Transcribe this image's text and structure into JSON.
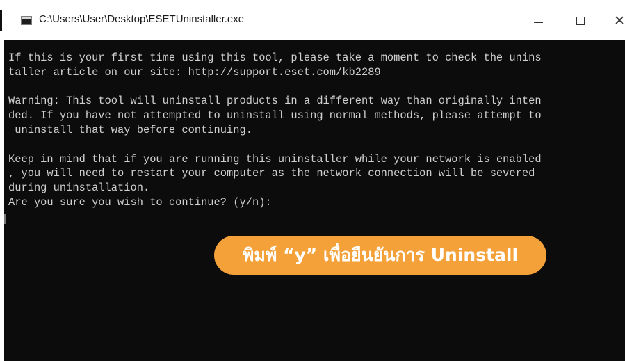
{
  "window": {
    "title": "C:\\Users\\User\\Desktop\\ESETUninstaller.exe",
    "controls": {
      "minimize": "minimize-icon",
      "maximize": "maximize-icon",
      "close": "close-icon"
    }
  },
  "console": {
    "lines": [
      "If this is your first time using this tool, please take a moment to check the unins",
      "taller article on our site: http://support.eset.com/kb2289",
      "",
      "Warning: This tool will uninstall products in a different way than originally inten",
      "ded. If you have not attempted to uninstall using normal methods, please attempt to",
      " uninstall that way before continuing.",
      "",
      "Keep in mind that if you are running this uninstaller while your network is enabled",
      ", you will need to restart your computer as the network connection will be severed",
      "during uninstallation.",
      "Are you sure you wish to continue? (y/n):"
    ]
  },
  "annotation": {
    "text": "พิมพ์ “y” เพื่อยืนยันการ Uninstall",
    "color": "#f4a13a"
  },
  "colors": {
    "console_bg": "#0c0c0c",
    "console_fg": "#cfcfcf",
    "titlebar_bg": "#ffffff"
  }
}
